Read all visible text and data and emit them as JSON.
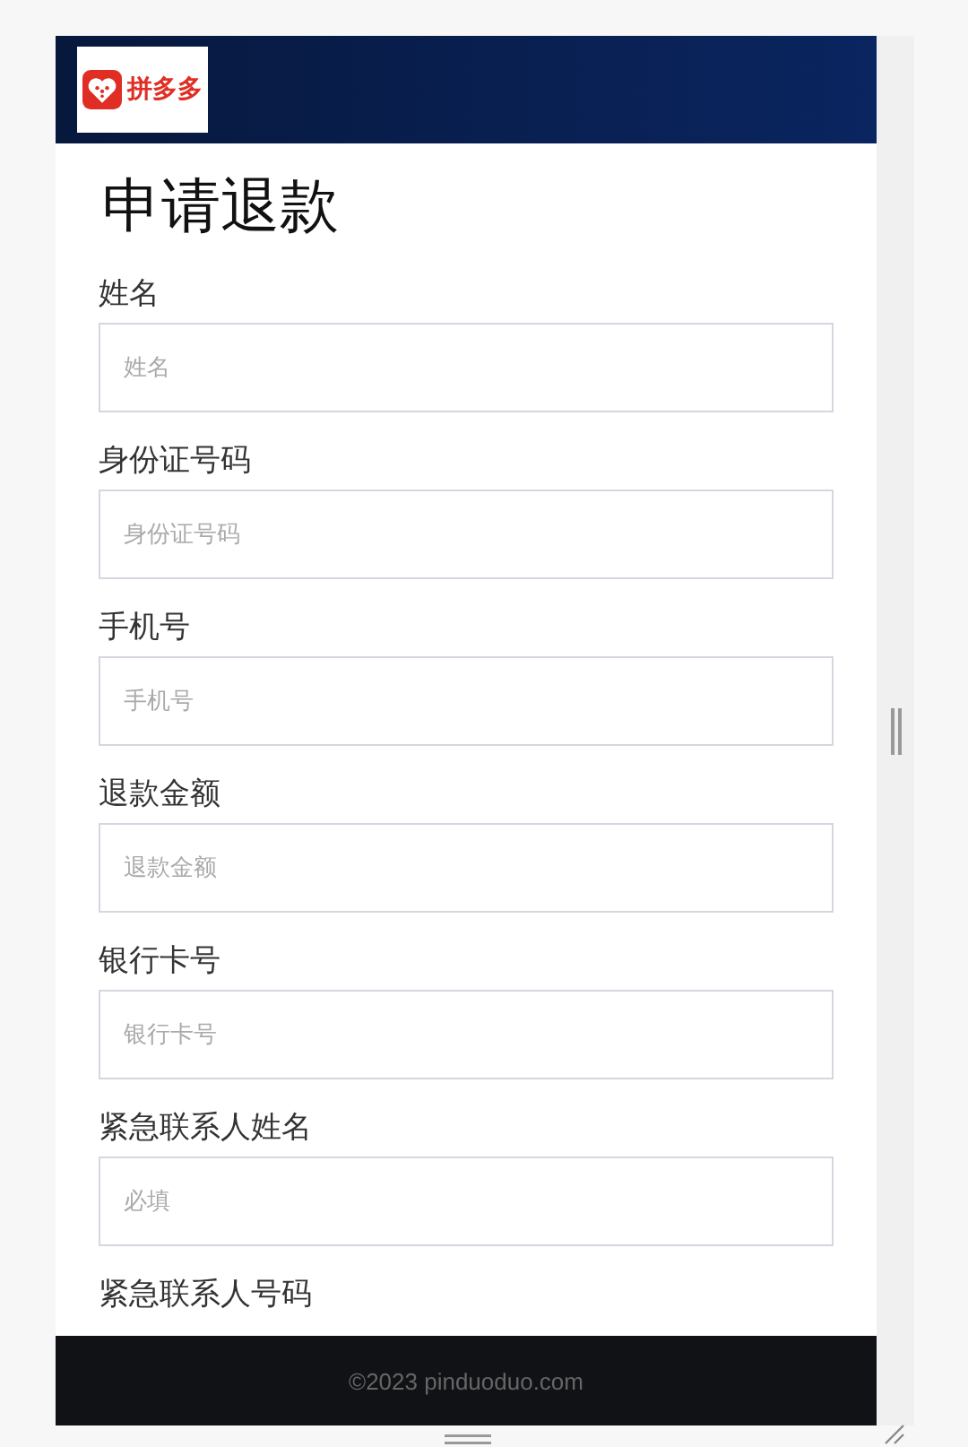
{
  "header": {
    "logo_text": "拼多多"
  },
  "form": {
    "title": "申请退款",
    "fields": [
      {
        "label": "姓名",
        "placeholder": "姓名"
      },
      {
        "label": "身份证号码",
        "placeholder": "身份证号码"
      },
      {
        "label": "手机号",
        "placeholder": "手机号"
      },
      {
        "label": "退款金额",
        "placeholder": "退款金额"
      },
      {
        "label": "银行卡号",
        "placeholder": "银行卡号"
      },
      {
        "label": "紧急联系人姓名",
        "placeholder": "必填"
      },
      {
        "label": "紧急联系人号码"
      }
    ]
  },
  "footer": {
    "copyright": "©2023 pinduoduo.com"
  }
}
